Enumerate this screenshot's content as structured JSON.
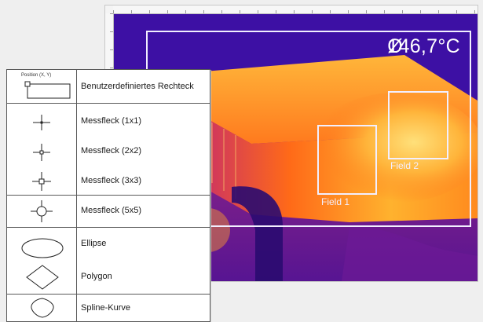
{
  "thermal_view": {
    "mean_symbol": "Ø",
    "mean_value": "146,7°C",
    "zones": [
      {
        "label": "Field 1"
      },
      {
        "label": "Field 2"
      }
    ]
  },
  "legend": {
    "rows": [
      {
        "symbol_icon": "rectangle-with-position-icon",
        "symbol_text": "Position (X, Y)",
        "label": "Benutzerdefiniertes Rechteck"
      },
      {
        "symbol_icon": "crosshair-1x1-icon",
        "label": "Messfleck (1x1)"
      },
      {
        "symbol_icon": "crosshair-2x2-icon",
        "label": "Messfleck (2x2)"
      },
      {
        "symbol_icon": "crosshair-3x3-icon",
        "label": "Messfleck (3x3)"
      },
      {
        "symbol_icon": "crosshair-5x5-icon",
        "label": "Messfleck (5x5)"
      },
      {
        "symbol_icon": "ellipse-icon",
        "label": "Ellipse"
      },
      {
        "symbol_icon": "polygon-icon",
        "label": "Polygon"
      },
      {
        "symbol_icon": "spline-curve-icon",
        "label": "Spline-Kurve"
      }
    ]
  },
  "colors": {
    "overlay_lines": "#f2efff",
    "thermal_cold": "#3a0f9a",
    "thermal_hot": "#ffd24a"
  }
}
